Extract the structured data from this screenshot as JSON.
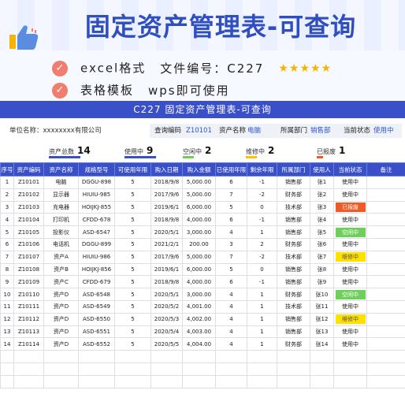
{
  "banner": {
    "title": "固定资产管理表-可查询",
    "feature1": "excel格式",
    "feature1_extra": "文件编号：C227",
    "stars": "★★★★★",
    "feature2": "表格模板",
    "feature2_extra": "wps即可使用",
    "check_icon": "✓"
  },
  "sheet": {
    "title": "C227 固定资产管理表-可查询",
    "unit_label": "单位名称：",
    "unit_value": "xxxxxxxx有限公司",
    "query_label": "查询编码",
    "query_value": "Z10101",
    "asset_name_label": "资产名称",
    "asset_name_value": "电脑",
    "dept_label": "所属部门",
    "dept_value": "销售部",
    "status_label": "当前状态",
    "status_value": "使用中"
  },
  "stats": [
    {
      "label": "资产总数",
      "value": "14",
      "bar_color": "#3a50c8"
    },
    {
      "label": "使用中",
      "value": "9",
      "bar_color": "#3a50c8"
    },
    {
      "label": "空闲中",
      "value": "2",
      "bar_color": "#6fcf5a"
    },
    {
      "label": "维修中",
      "value": "2",
      "bar_color": "#ffc000"
    },
    {
      "label": "已报废",
      "value": "1",
      "bar_color": "#f15a24"
    }
  ],
  "table": {
    "headers": [
      "序号",
      "资产编码",
      "资产名称",
      "规格型号",
      "可使用年限",
      "购入日期",
      "购入金额",
      "已使用年限",
      "剩余年限",
      "所属部门",
      "使用人",
      "当前状态",
      "备注"
    ],
    "rows": [
      [
        "1",
        "Z10101",
        "电脑",
        "DGGU-898",
        "5",
        "2018/9/8",
        "5,000.00",
        "6",
        "-1",
        "销售部",
        "张1",
        "使用中",
        ""
      ],
      [
        "2",
        "Z10102",
        "显示器",
        "HIUIU-985",
        "5",
        "2017/9/6",
        "5,000.00",
        "7",
        "-2",
        "财务部",
        "张2",
        "使用中",
        ""
      ],
      [
        "3",
        "Z10103",
        "充电器",
        "HOIJKJ-855",
        "5",
        "2019/6/1",
        "6,000.00",
        "5",
        "0",
        "技术部",
        "张3",
        "已报废",
        ""
      ],
      [
        "4",
        "Z10104",
        "打印机",
        "CFDD-678",
        "5",
        "2018/9/8",
        "4,000.00",
        "6",
        "-1",
        "销售部",
        "张4",
        "使用中",
        ""
      ],
      [
        "5",
        "Z10105",
        "投影仪",
        "ASD-6547",
        "5",
        "2020/5/1",
        "3,000.00",
        "4",
        "1",
        "销售部",
        "张5",
        "空闲中",
        ""
      ],
      [
        "6",
        "Z10106",
        "电话机",
        "DGGU-899",
        "5",
        "2021/2/1",
        "200.00",
        "3",
        "2",
        "财务部",
        "张6",
        "使用中",
        ""
      ],
      [
        "7",
        "Z10107",
        "资产A",
        "HIUIU-986",
        "5",
        "2017/9/6",
        "5,000.00",
        "7",
        "-2",
        "技术部",
        "张7",
        "维修中",
        ""
      ],
      [
        "8",
        "Z10108",
        "资产B",
        "HOIJKJ-856",
        "5",
        "2019/6/1",
        "6,000.00",
        "5",
        "0",
        "销售部",
        "张8",
        "使用中",
        ""
      ],
      [
        "9",
        "Z10109",
        "资产C",
        "CFDD-679",
        "5",
        "2018/9/8",
        "4,000.00",
        "6",
        "-1",
        "销售部",
        "张9",
        "使用中",
        ""
      ],
      [
        "10",
        "Z10110",
        "资产D",
        "ASD-6548",
        "5",
        "2020/5/1",
        "3,000.00",
        "4",
        "1",
        "财务部",
        "张10",
        "空闲中",
        ""
      ],
      [
        "11",
        "Z10111",
        "资产D",
        "ASD-6549",
        "5",
        "2020/5/2",
        "4,001.00",
        "4",
        "1",
        "技术部",
        "张11",
        "使用中",
        ""
      ],
      [
        "12",
        "Z10112",
        "资产D",
        "ASD-6550",
        "5",
        "2020/5/3",
        "4,002.00",
        "4",
        "1",
        "销售部",
        "张12",
        "维修中",
        ""
      ],
      [
        "13",
        "Z10113",
        "资产D",
        "ASD-6551",
        "5",
        "2020/5/4",
        "4,003.00",
        "4",
        "1",
        "销售部",
        "张13",
        "使用中",
        ""
      ],
      [
        "14",
        "Z10114",
        "资产D",
        "ASD-6552",
        "5",
        "2020/5/5",
        "4,004.00",
        "4",
        "1",
        "财务部",
        "张14",
        "使用中",
        ""
      ]
    ],
    "status_colors": {
      "已报废": "b-orange",
      "空闲中": "b-green",
      "维修中": "b-yellow"
    }
  }
}
